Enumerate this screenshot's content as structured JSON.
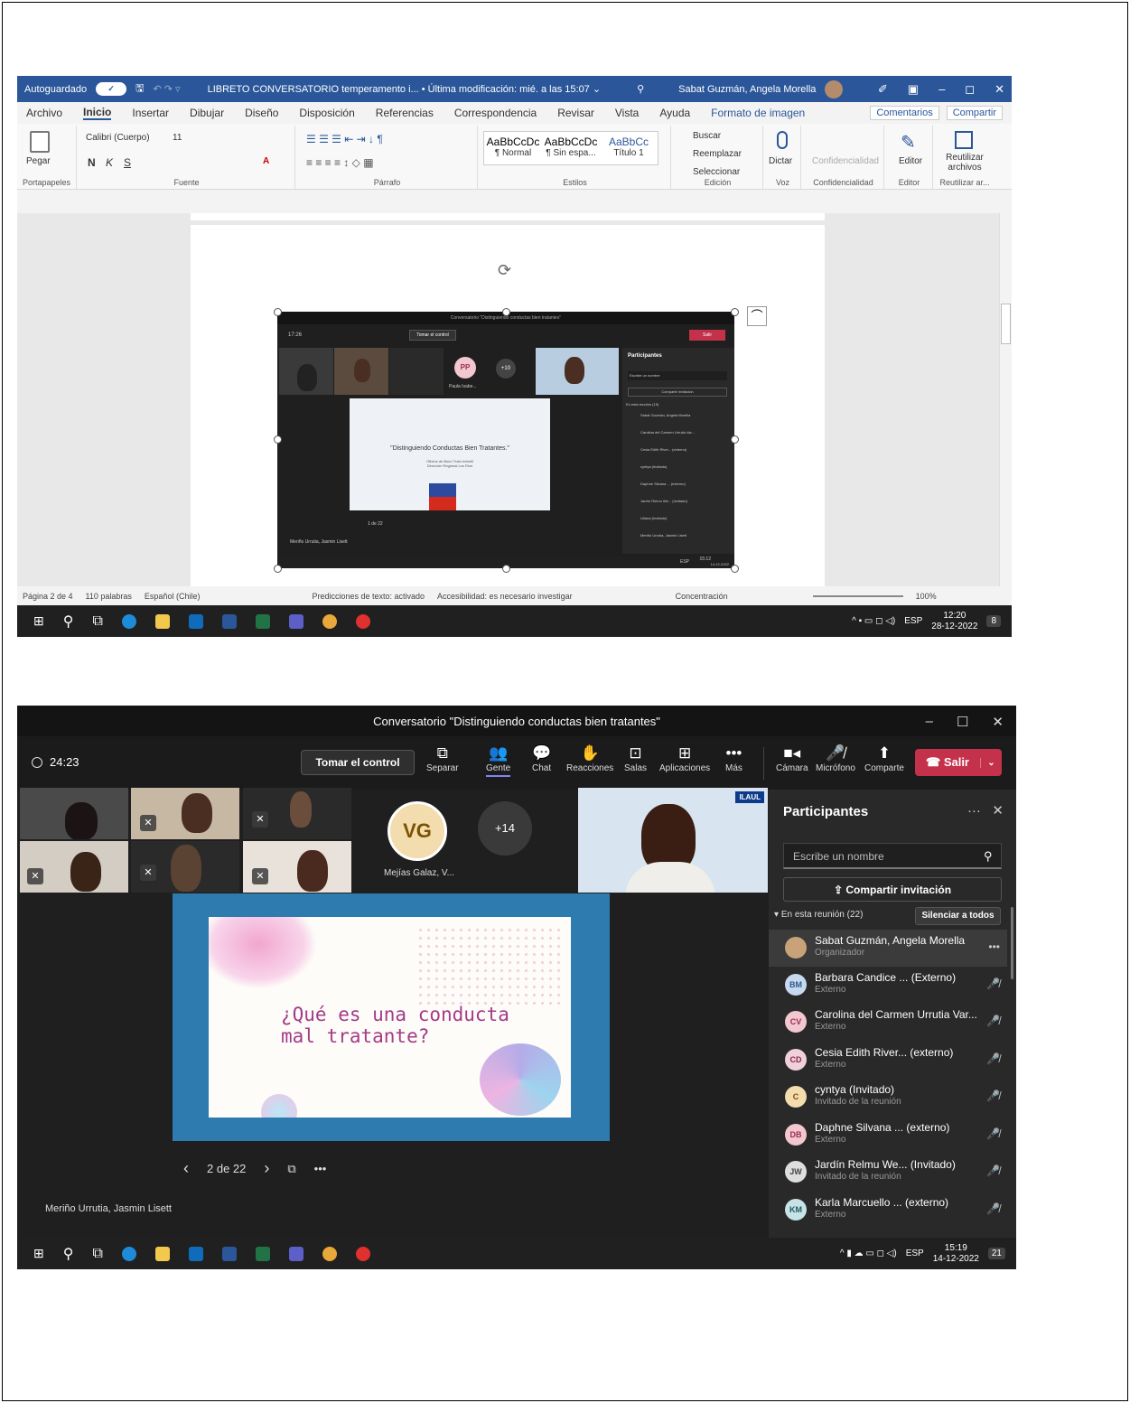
{
  "word": {
    "autosave": "Autoguardado",
    "autosave_toggle": "✓",
    "doc_title": "LIBRETO CONVERSATORIO temperamento i... • Última modificación: mié. a las 15:07 ⌄",
    "user": "Sabat Guzmán, Angela Morella",
    "menu": [
      "Archivo",
      "Inicio",
      "Insertar",
      "Dibujar",
      "Diseño",
      "Disposición",
      "Referencias",
      "Correspondencia",
      "Revisar",
      "Vista",
      "Ayuda"
    ],
    "menu_active": "Inicio",
    "format_tab": "Formato de imagen",
    "comments_btn": "Comentarios",
    "share_btn": "Compartir",
    "paste": "Pegar",
    "font_name": "Calibri (Cuerpo)",
    "font_size": "11",
    "bold": "N",
    "italic": "K",
    "underline": "S",
    "styles": [
      {
        "sample": "AaBbCcDc",
        "name": "¶ Normal"
      },
      {
        "sample": "AaBbCcDc",
        "name": "¶ Sin espa..."
      },
      {
        "sample": "AaBbCc",
        "name": "Título 1"
      }
    ],
    "edit_items": [
      "Buscar",
      "Reemplazar",
      "Seleccionar"
    ],
    "dictate": "Dictar",
    "confidentiality": "Confidencialidad",
    "editor": "Editor",
    "reuse": "Reutilizar archivos",
    "groups": [
      "Portapapeles",
      "Fuente",
      "Párrafo",
      "Estilos",
      "Edición",
      "Voz",
      "Confidencialidad",
      "Editor",
      "Reutilizar ar..."
    ],
    "status": {
      "page": "Página 2 de 4",
      "words": "110 palabras",
      "lang": "Español (Chile)",
      "predict": "Predicciones de texto: activado",
      "access": "Accesibilidad: es necesario investigar",
      "focus": "Concentración",
      "zoom": "100%"
    },
    "taskbar": {
      "lang": "ESP",
      "time": "12:20",
      "date": "28-12-2022",
      "badge": "8"
    },
    "embedded": {
      "title": "Conversatorio \"Distinguiendo conductas bien tratantes\"",
      "timer": "17:26",
      "take_control": "Tomar el control",
      "avatar": "PP",
      "avatar_name": "Paula Isabe...",
      "more": "+10",
      "slide_title": "\"Distinguiendo Conductas Bien Tratantes.\"",
      "slide_sub1": "Oficina de Buen Trato Infantil",
      "slide_sub2": "Dirección Regional Los Ríos",
      "pager": "1 de 22",
      "presenter": "Meriño Urrutia, Jasmin Lisett",
      "panel_title": "Participantes",
      "search": "Escribe un nombre",
      "share": "Compartir invitación",
      "in_meeting": "En esta reunión (19)",
      "leave": "Salir",
      "participants": [
        {
          "name": "Sabat Guzmán, Angela Morella",
          "sub": "Organizador"
        },
        {
          "name": "Carolina del Carmen Urrutia Var...",
          "sub": "Externo"
        },
        {
          "name": "Cesia Edith River... (externo)",
          "sub": "Externo"
        },
        {
          "name": "cyntya (Invitado)",
          "sub": "Invitado de la reunión"
        },
        {
          "name": "Daphne Silvana ... (externo)",
          "sub": "Externo"
        },
        {
          "name": "Jardín Relmu We... (Invitado)",
          "sub": "Invitado de la reunión"
        },
        {
          "name": "Liliana (Invitado)",
          "sub": "Invitado de la reunión"
        },
        {
          "name": "Meriño Urrutia, Jasmin Lisett",
          "sub": ""
        }
      ],
      "clock_time": "15:12",
      "clock_date": "14-12-2022",
      "lang": "ESP"
    }
  },
  "teams": {
    "title": "Conversatorio \"Distinguiendo conductas bien tratantes\"",
    "timer": "24:23",
    "take_control": "Tomar el control",
    "tools": [
      "Separar",
      "Gente",
      "Chat",
      "Reacciones",
      "Salas",
      "Aplicaciones",
      "Más"
    ],
    "media": [
      "Cámara",
      "Micrófono",
      "Comparte"
    ],
    "leave": "Salir",
    "tile_avatar": "VG",
    "tile_name": "Mejías Galaz, V...",
    "more_count": "+14",
    "badge": "ILAUL",
    "slide_text_1": "¿Qué es una conducta",
    "slide_text_2": "mal tratante?",
    "pager": "2 de 22",
    "presenter": "Meriño Urrutia, Jasmin Lisett",
    "panel_title": "Participantes",
    "search_placeholder": "Escribe un nombre",
    "share_invite": "Compartir invitación",
    "in_meeting": "En esta reunión (22)",
    "mute_all": "Silenciar a todos",
    "participants": [
      {
        "initials": "",
        "name": "Sabat Guzmán, Angela Morella",
        "sub": "Organizador",
        "color": "#c9a27a"
      },
      {
        "initials": "BM",
        "name": "Barbara Candice ... (Externo)",
        "sub": "Externo",
        "color": "#c7d9ef"
      },
      {
        "initials": "CV",
        "name": "Carolina del Carmen Urrutia Var...",
        "sub": "Externo",
        "color": "#f2c7cf"
      },
      {
        "initials": "CD",
        "name": "Cesia Edith River... (externo)",
        "sub": "Externo",
        "color": "#efd0db"
      },
      {
        "initials": "C",
        "name": "cyntya (Invitado)",
        "sub": "Invitado de la reunión",
        "color": "#f3dcae"
      },
      {
        "initials": "DB",
        "name": "Daphne Silvana ... (externo)",
        "sub": "Externo",
        "color": "#f2c7cf"
      },
      {
        "initials": "JW",
        "name": "Jardín Relmu We... (Invitado)",
        "sub": "Invitado de la reunión",
        "color": "#dedede"
      },
      {
        "initials": "KM",
        "name": "Karla Marcuello ... (externo)",
        "sub": "Externo",
        "color": "#c7e3e6"
      }
    ],
    "taskbar": {
      "lang": "ESP",
      "time": "15:19",
      "date": "14-12-2022",
      "badge": "21"
    }
  }
}
